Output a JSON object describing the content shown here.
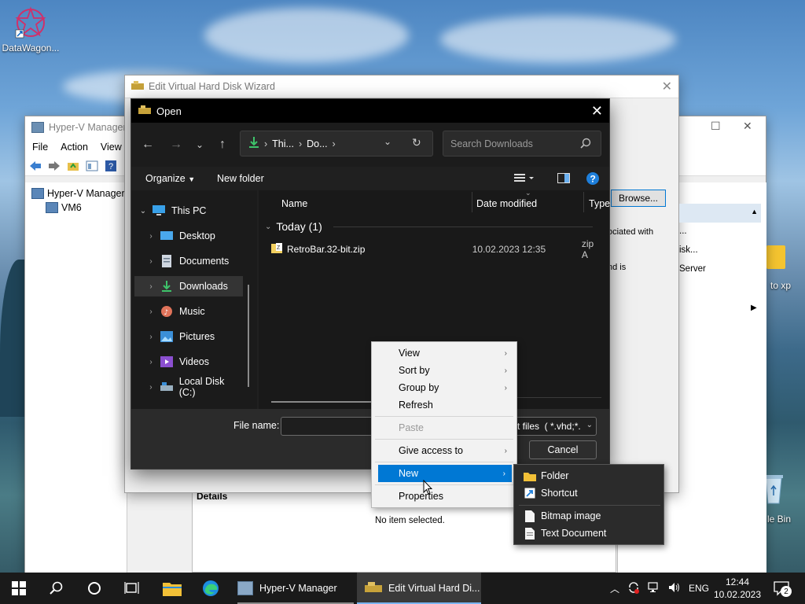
{
  "desktop": {
    "icons": [
      {
        "label": "DataWagon..."
      },
      {
        "label": "to xp"
      },
      {
        "label": "le Bin"
      }
    ]
  },
  "hyperv": {
    "title": "Hyper-V Manager",
    "menu": [
      "File",
      "Action",
      "View"
    ],
    "tree": [
      "Hyper-V Manager",
      "VM6"
    ],
    "details_label": "Details",
    "no_item": "No item selected."
  },
  "wizard": {
    "title": "Edit Virtual Hard Disk Wizard",
    "browse_label": "Browse...",
    "text_1": "ociated with",
    "text_2": "nd is",
    "right_items": [
      "...",
      "isk...",
      "Server"
    ]
  },
  "open_dialog": {
    "title": "Open",
    "address": {
      "part_1": "Thi...",
      "part_2": "Do..."
    },
    "search_placeholder": "Search Downloads",
    "organize_label": "Organize",
    "new_folder_label": "New folder",
    "nav": [
      {
        "label": "This PC",
        "icon": "pc-icon"
      },
      {
        "label": "Desktop",
        "icon": "desktop-icon"
      },
      {
        "label": "Documents",
        "icon": "documents-icon"
      },
      {
        "label": "Downloads",
        "icon": "download-icon"
      },
      {
        "label": "Music",
        "icon": "music-icon"
      },
      {
        "label": "Pictures",
        "icon": "pictures-icon"
      },
      {
        "label": "Videos",
        "icon": "videos-icon"
      },
      {
        "label": "Local Disk (C:)",
        "icon": "disk-icon"
      }
    ],
    "columns": {
      "name": "Name",
      "date": "Date modified",
      "type": "Type"
    },
    "group_label": "Today (1)",
    "files": [
      {
        "name": "RetroBar.32-bit.zip",
        "date": "10.02.2023 12:35",
        "type": "zip A"
      }
    ],
    "file_name_label": "File name:",
    "filter_text": "t files  ( *.vhd;*.",
    "cancel_label": "Cancel"
  },
  "context_menu": {
    "items": [
      {
        "label": "View",
        "submenu": true
      },
      {
        "label": "Sort by",
        "submenu": true
      },
      {
        "label": "Group by",
        "submenu": true
      },
      {
        "label": "Refresh"
      },
      {
        "label": "Paste",
        "disabled": true
      },
      {
        "label": "Give access to",
        "submenu": true
      },
      {
        "label": "New",
        "submenu": true,
        "active": true
      },
      {
        "label": "Properties"
      }
    ]
  },
  "new_submenu": {
    "items": [
      {
        "label": "Folder",
        "icon": "folder-icon"
      },
      {
        "label": "Shortcut",
        "icon": "shortcut-icon"
      },
      {
        "label": "Bitmap image",
        "icon": "document-icon"
      },
      {
        "label": "Text Document",
        "icon": "document-icon"
      }
    ]
  },
  "taskbar": {
    "apps": [
      {
        "label": "Hyper-V Manager"
      },
      {
        "label": "Edit Virtual Hard Di..."
      }
    ],
    "language": "ENG",
    "time": "12:44",
    "date": "10.02.2023",
    "notification_count": "2"
  },
  "colors": {
    "accent": "#0078d4",
    "dialog_bg": "#202020",
    "taskbar_bg": "#1a1a1a"
  }
}
